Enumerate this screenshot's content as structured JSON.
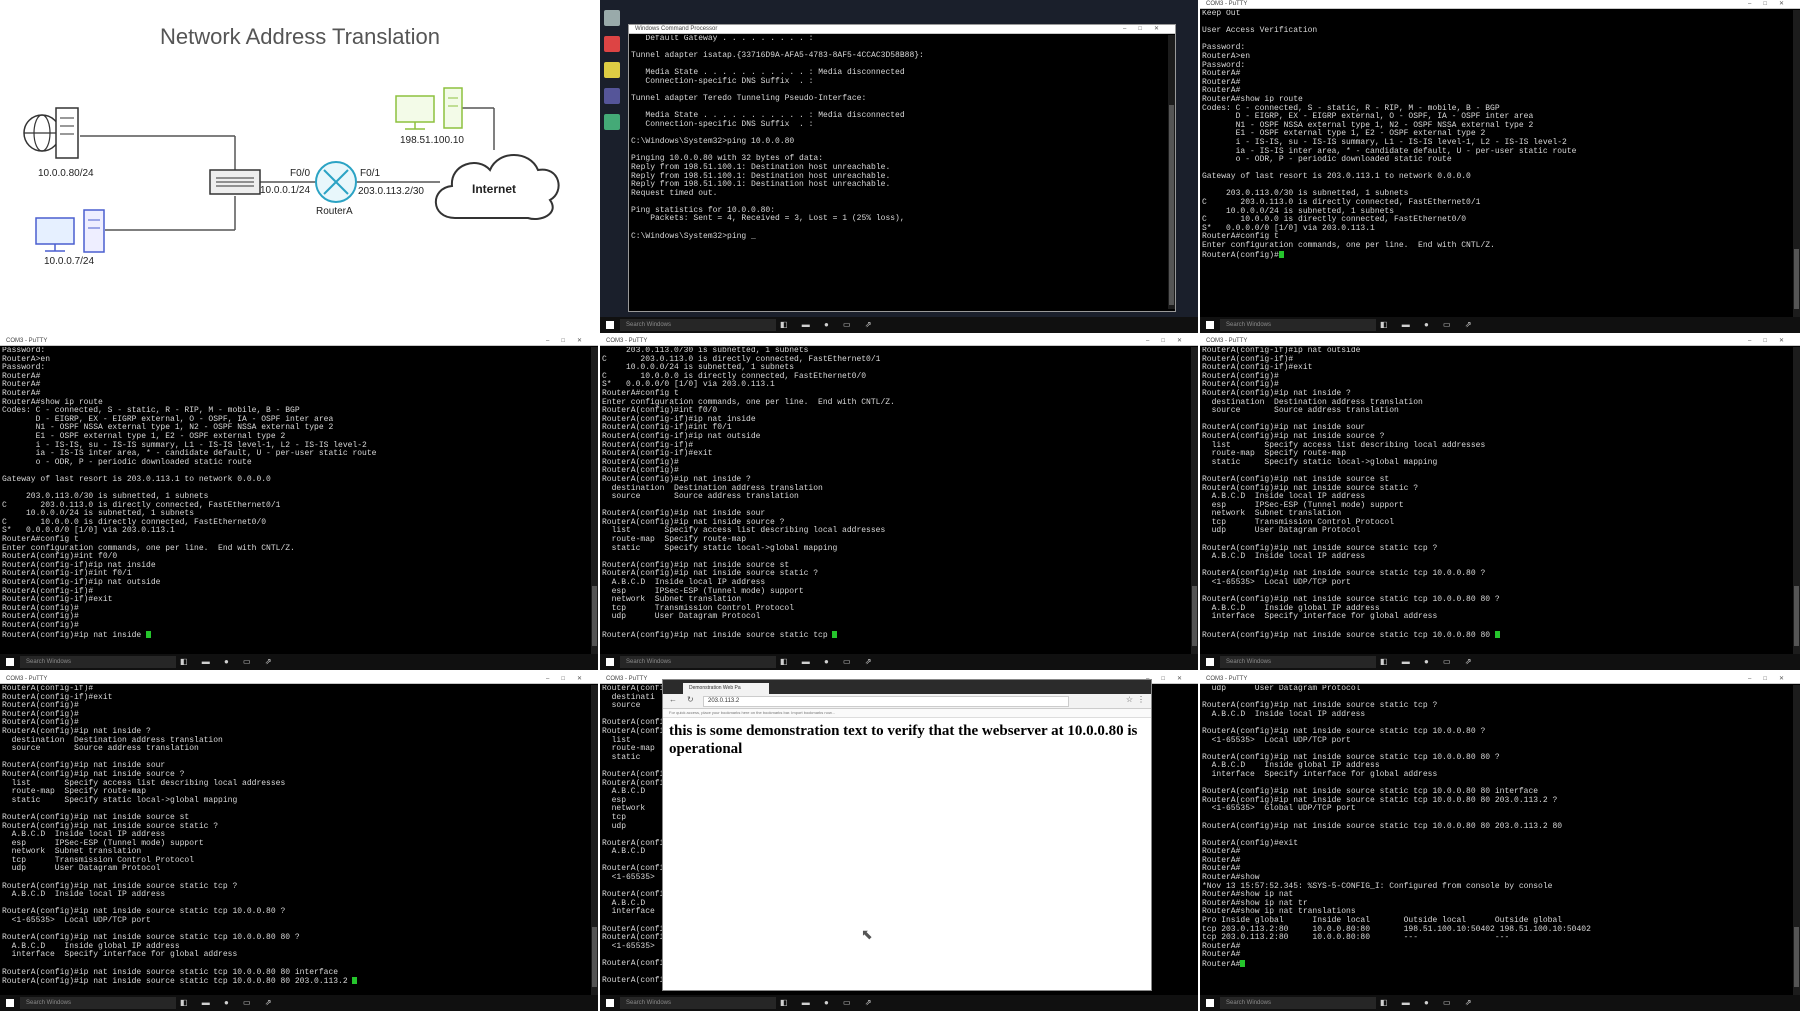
{
  "diagram": {
    "title": "Network Address Translation",
    "server_ip": "10.0.0.80/24",
    "pc_ip": "10.0.0.7/24",
    "remote_ip": "198.51.100.10",
    "router_label": "RouterA",
    "f00_label": "F0/0",
    "f00_ip": "10.0.0.1/24",
    "f01_label": "F0/1",
    "f01_ip": "203.0.113.2/30",
    "cloud_label": "Internet"
  },
  "cmd_window": {
    "title": "Windows Command Processor",
    "lines": "   Default Gateway . . . . . . . . . :\n\nTunnel adapter isatap.{33716D9A-AFA5-4783-8AF5-4CCAC3D58B88}:\n\n   Media State . . . . . . . . . . . : Media disconnected\n   Connection-specific DNS Suffix  . :\n\nTunnel adapter Teredo Tunneling Pseudo-Interface:\n\n   Media State . . . . . . . . . . . : Media disconnected\n   Connection-specific DNS Suffix  . :\n\nC:\\Windows\\System32>ping 10.0.0.80\n\nPinging 10.0.0.80 with 32 bytes of data:\nReply from 198.51.100.1: Destination host unreachable.\nReply from 198.51.100.1: Destination host unreachable.\nReply from 198.51.100.1: Destination host unreachable.\nRequest timed out.\n\nPing statistics for 10.0.0.80:\n    Packets: Sent = 4, Received = 3, Lost = 1 (25% loss),\n\nC:\\Windows\\System32>ping _"
  },
  "putty1": {
    "title": "COM3 - PuTTY",
    "lines": "Keep Out\n\nUser Access Verification\n\nPassword:\nRouterA>en\nPassword:\nRouterA#\nRouterA#\nRouterA#\nRouterA#show ip route\nCodes: C - connected, S - static, R - RIP, M - mobile, B - BGP\n       D - EIGRP, EX - EIGRP external, O - OSPF, IA - OSPF inter area\n       N1 - OSPF NSSA external type 1, N2 - OSPF NSSA external type 2\n       E1 - OSPF external type 1, E2 - OSPF external type 2\n       i - IS-IS, su - IS-IS summary, L1 - IS-IS level-1, L2 - IS-IS level-2\n       ia - IS-IS inter area, * - candidate default, U - per-user static route\n       o - ODR, P - periodic downloaded static route\n\nGateway of last resort is 203.0.113.1 to network 0.0.0.0\n\n     203.0.113.0/30 is subnetted, 1 subnets\nC       203.0.113.0 is directly connected, FastEthernet0/1\n     10.0.0.0/24 is subnetted, 1 subnets\nC       10.0.0.0 is directly connected, FastEthernet0/0\nS*   0.0.0.0/0 [1/0] via 203.0.113.1\nRouterA#config t\nEnter configuration commands, one per line.  End with CNTL/Z.\nRouterA(config)#"
  },
  "putty2": {
    "title": "COM3 - PuTTY",
    "lines": "Password:\nRouterA>en\nPassword:\nRouterA#\nRouterA#\nRouterA#\nRouterA#show ip route\nCodes: C - connected, S - static, R - RIP, M - mobile, B - BGP\n       D - EIGRP, EX - EIGRP external, O - OSPF, IA - OSPF inter area\n       N1 - OSPF NSSA external type 1, N2 - OSPF NSSA external type 2\n       E1 - OSPF external type 1, E2 - OSPF external type 2\n       i - IS-IS, su - IS-IS summary, L1 - IS-IS level-1, L2 - IS-IS level-2\n       ia - IS-IS inter area, * - candidate default, U - per-user static route\n       o - ODR, P - periodic downloaded static route\n\nGateway of last resort is 203.0.113.1 to network 0.0.0.0\n\n     203.0.113.0/30 is subnetted, 1 subnets\nC       203.0.113.0 is directly connected, FastEthernet0/1\n     10.0.0.0/24 is subnetted, 1 subnets\nC       10.0.0.0 is directly connected, FastEthernet0/0\nS*   0.0.0.0/0 [1/0] via 203.0.113.1\nRouterA#config t\nEnter configuration commands, one per line.  End with CNTL/Z.\nRouterA(config)#int f0/0\nRouterA(config-if)#ip nat inside\nRouterA(config-if)#int f0/1\nRouterA(config-if)#ip nat outside\nRouterA(config-if)#\nRouterA(config-if)#exit\nRouterA(config)#\nRouterA(config)#\nRouterA(config)#\nRouterA(config)#ip nat inside "
  },
  "putty3": {
    "title": "COM3 - PuTTY",
    "lines": "     203.0.113.0/30 is subnetted, 1 subnets\nC       203.0.113.0 is directly connected, FastEthernet0/1\n     10.0.0.0/24 is subnetted, 1 subnets\nC       10.0.0.0 is directly connected, FastEthernet0/0\nS*   0.0.0.0/0 [1/0] via 203.0.113.1\nRouterA#config t\nEnter configuration commands, one per line.  End with CNTL/Z.\nRouterA(config)#int f0/0\nRouterA(config-if)#ip nat inside\nRouterA(config-if)#int f0/1\nRouterA(config-if)#ip nat outside\nRouterA(config-if)#\nRouterA(config-if)#exit\nRouterA(config)#\nRouterA(config)#\nRouterA(config)#ip nat inside ?\n  destination  Destination address translation\n  source       Source address translation\n\nRouterA(config)#ip nat inside sour\nRouterA(config)#ip nat inside source ?\n  list       Specify access list describing local addresses\n  route-map  Specify route-map\n  static     Specify static local->global mapping\n\nRouterA(config)#ip nat inside source st\nRouterA(config)#ip nat inside source static ?\n  A.B.C.D  Inside local IP address\n  esp      IPSec-ESP (Tunnel mode) support\n  network  Subnet translation\n  tcp      Transmission Control Protocol\n  udp      User Datagram Protocol\n\nRouterA(config)#ip nat inside source static tcp "
  },
  "putty4": {
    "title": "COM3 - PuTTY",
    "lines": "RouterA(config-if)#ip nat outside\nRouterA(config-if)#\nRouterA(config-if)#exit\nRouterA(config)#\nRouterA(config)#\nRouterA(config)#ip nat inside ?\n  destination  Destination address translation\n  source       Source address translation\n\nRouterA(config)#ip nat inside sour\nRouterA(config)#ip nat inside source ?\n  list       Specify access list describing local addresses\n  route-map  Specify route-map\n  static     Specify static local->global mapping\n\nRouterA(config)#ip nat inside source st\nRouterA(config)#ip nat inside source static ?\n  A.B.C.D  Inside local IP address\n  esp      IPSec-ESP (Tunnel mode) support\n  network  Subnet translation\n  tcp      Transmission Control Protocol\n  udp      User Datagram Protocol\n\nRouterA(config)#ip nat inside source static tcp ?\n  A.B.C.D  Inside local IP address\n\nRouterA(config)#ip nat inside source static tcp 10.0.0.80 ?\n  <1-65535>  Local UDP/TCP port\n\nRouterA(config)#ip nat inside source static tcp 10.0.0.80 80 ?\n  A.B.C.D    Inside global IP address\n  interface  Specify interface for global address\n\nRouterA(config)#ip nat inside source static tcp 10.0.0.80 80 "
  },
  "putty5": {
    "title": "COM3 - PuTTY",
    "lines": "RouterA(config-if)#\nRouterA(config-if)#exit\nRouterA(config)#\nRouterA(config)#\nRouterA(config)#\nRouterA(config)#ip nat inside ?\n  destination  Destination address translation\n  source       Source address translation\n\nRouterA(config)#ip nat inside sour\nRouterA(config)#ip nat inside source ?\n  list       Specify access list describing local addresses\n  route-map  Specify route-map\n  static     Specify static local->global mapping\n\nRouterA(config)#ip nat inside source st\nRouterA(config)#ip nat inside source static ?\n  A.B.C.D  Inside local IP address\n  esp      IPSec-ESP (Tunnel mode) support\n  network  Subnet translation\n  tcp      Transmission Control Protocol\n  udp      User Datagram Protocol\n\nRouterA(config)#ip nat inside source static tcp ?\n  A.B.C.D  Inside local IP address\n\nRouterA(config)#ip nat inside source static tcp 10.0.0.80 ?\n  <1-65535>  Local UDP/TCP port\n\nRouterA(config)#ip nat inside source static tcp 10.0.0.80 80 ?\n  A.B.C.D    Inside global IP address\n  interface  Specify interface for global address\n\nRouterA(config)#ip nat inside source static tcp 10.0.0.80 80 interface\nRouterA(config)#ip nat inside source static tcp 10.0.0.80 80 203.0.113.2 "
  },
  "putty6": {
    "title": "COM3 - PuTTY",
    "lines": "RouterA(config\n  destinati\n  source\n\nRouterA(config\nRouterA(config\n  list\n  route-map\n  static\n\nRouterA(config\nRouterA(config\n  A.B.C.D\n  esp\n  network\n  tcp\n  udp\n\nRouterA(config\n  A.B.C.D\n\nRouterA(config\n  <1-65535>\n\nRouterA(config\n  A.B.C.D\n  interface\n\nRouterA(config\nRouterA(config\n  <1-65535>\n\nRouterA(config\n\nRouterA(config"
  },
  "browser": {
    "tab_title": "Demonstration Web Pa",
    "url": "203.0.113.2",
    "bookmarks_hint": "For quick access, place your bookmarks here on the bookmarks bar. Import bookmarks now...",
    "page_text": "this is some demonstration text to verify that the webserver at 10.0.0.80 is operational"
  },
  "putty7": {
    "title": "COM3 - PuTTY",
    "lines": "  udp      User Datagram Protocol\n\nRouterA(config)#ip nat inside source static tcp ?\n  A.B.C.D  Inside local IP address\n\nRouterA(config)#ip nat inside source static tcp 10.0.0.80 ?\n  <1-65535>  Local UDP/TCP port\n\nRouterA(config)#ip nat inside source static tcp 10.0.0.80 80 ?\n  A.B.C.D    Inside global IP address\n  interface  Specify interface for global address\n\nRouterA(config)#ip nat inside source static tcp 10.0.0.80 80 interface\nRouterA(config)#ip nat inside source static tcp 10.0.0.80 80 203.0.113.2 ?\n  <1-65535>  Global UDP/TCP port\n\nRouterA(config)#ip nat inside source static tcp 10.0.0.80 80 203.0.113.2 80\n\nRouterA(config)#exit\nRouterA#\nRouterA#\nRouterA#\nRouterA#show\n*Nov 13 15:57:52.345: %SYS-5-CONFIG_I: Configured from console by console\nRouterA#show ip nat\nRouterA#show ip nat tr\nRouterA#show ip nat translations\nPro Inside global      Inside local       Outside local      Outside global\ntcp 203.0.113.2:80     10.0.0.80:80       198.51.100.10:50402 198.51.100.10:50402\ntcp 203.0.113.2:80     10.0.0.80:80       ---                ---\nRouterA#\nRouterA#\nRouterA#"
  },
  "taskbar": {
    "search_placeholder": "Search Windows",
    "icons": "◧ ▬ ● ▭ ⇗"
  }
}
